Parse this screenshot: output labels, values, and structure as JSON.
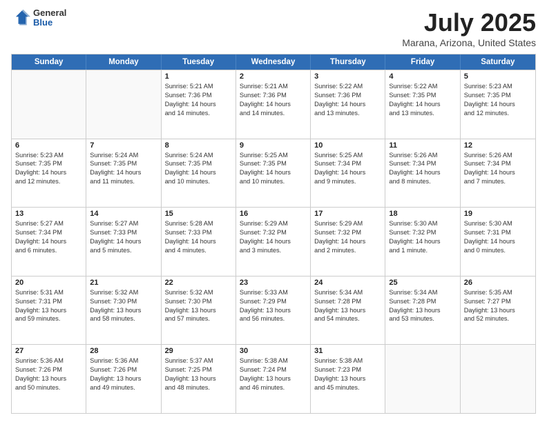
{
  "header": {
    "logo": {
      "general": "General",
      "blue": "Blue"
    },
    "title": "July 2025",
    "subtitle": "Marana, Arizona, United States"
  },
  "calendar": {
    "days_of_week": [
      "Sunday",
      "Monday",
      "Tuesday",
      "Wednesday",
      "Thursday",
      "Friday",
      "Saturday"
    ],
    "rows": [
      [
        {
          "day": "",
          "empty": true
        },
        {
          "day": "",
          "empty": true
        },
        {
          "day": "1",
          "lines": [
            "Sunrise: 5:21 AM",
            "Sunset: 7:36 PM",
            "Daylight: 14 hours",
            "and 14 minutes."
          ]
        },
        {
          "day": "2",
          "lines": [
            "Sunrise: 5:21 AM",
            "Sunset: 7:36 PM",
            "Daylight: 14 hours",
            "and 14 minutes."
          ]
        },
        {
          "day": "3",
          "lines": [
            "Sunrise: 5:22 AM",
            "Sunset: 7:36 PM",
            "Daylight: 14 hours",
            "and 13 minutes."
          ]
        },
        {
          "day": "4",
          "lines": [
            "Sunrise: 5:22 AM",
            "Sunset: 7:35 PM",
            "Daylight: 14 hours",
            "and 13 minutes."
          ]
        },
        {
          "day": "5",
          "lines": [
            "Sunrise: 5:23 AM",
            "Sunset: 7:35 PM",
            "Daylight: 14 hours",
            "and 12 minutes."
          ]
        }
      ],
      [
        {
          "day": "6",
          "lines": [
            "Sunrise: 5:23 AM",
            "Sunset: 7:35 PM",
            "Daylight: 14 hours",
            "and 12 minutes."
          ]
        },
        {
          "day": "7",
          "lines": [
            "Sunrise: 5:24 AM",
            "Sunset: 7:35 PM",
            "Daylight: 14 hours",
            "and 11 minutes."
          ]
        },
        {
          "day": "8",
          "lines": [
            "Sunrise: 5:24 AM",
            "Sunset: 7:35 PM",
            "Daylight: 14 hours",
            "and 10 minutes."
          ]
        },
        {
          "day": "9",
          "lines": [
            "Sunrise: 5:25 AM",
            "Sunset: 7:35 PM",
            "Daylight: 14 hours",
            "and 10 minutes."
          ]
        },
        {
          "day": "10",
          "lines": [
            "Sunrise: 5:25 AM",
            "Sunset: 7:34 PM",
            "Daylight: 14 hours",
            "and 9 minutes."
          ]
        },
        {
          "day": "11",
          "lines": [
            "Sunrise: 5:26 AM",
            "Sunset: 7:34 PM",
            "Daylight: 14 hours",
            "and 8 minutes."
          ]
        },
        {
          "day": "12",
          "lines": [
            "Sunrise: 5:26 AM",
            "Sunset: 7:34 PM",
            "Daylight: 14 hours",
            "and 7 minutes."
          ]
        }
      ],
      [
        {
          "day": "13",
          "lines": [
            "Sunrise: 5:27 AM",
            "Sunset: 7:34 PM",
            "Daylight: 14 hours",
            "and 6 minutes."
          ]
        },
        {
          "day": "14",
          "lines": [
            "Sunrise: 5:27 AM",
            "Sunset: 7:33 PM",
            "Daylight: 14 hours",
            "and 5 minutes."
          ]
        },
        {
          "day": "15",
          "lines": [
            "Sunrise: 5:28 AM",
            "Sunset: 7:33 PM",
            "Daylight: 14 hours",
            "and 4 minutes."
          ]
        },
        {
          "day": "16",
          "lines": [
            "Sunrise: 5:29 AM",
            "Sunset: 7:32 PM",
            "Daylight: 14 hours",
            "and 3 minutes."
          ]
        },
        {
          "day": "17",
          "lines": [
            "Sunrise: 5:29 AM",
            "Sunset: 7:32 PM",
            "Daylight: 14 hours",
            "and 2 minutes."
          ]
        },
        {
          "day": "18",
          "lines": [
            "Sunrise: 5:30 AM",
            "Sunset: 7:32 PM",
            "Daylight: 14 hours",
            "and 1 minute."
          ]
        },
        {
          "day": "19",
          "lines": [
            "Sunrise: 5:30 AM",
            "Sunset: 7:31 PM",
            "Daylight: 14 hours",
            "and 0 minutes."
          ]
        }
      ],
      [
        {
          "day": "20",
          "lines": [
            "Sunrise: 5:31 AM",
            "Sunset: 7:31 PM",
            "Daylight: 13 hours",
            "and 59 minutes."
          ]
        },
        {
          "day": "21",
          "lines": [
            "Sunrise: 5:32 AM",
            "Sunset: 7:30 PM",
            "Daylight: 13 hours",
            "and 58 minutes."
          ]
        },
        {
          "day": "22",
          "lines": [
            "Sunrise: 5:32 AM",
            "Sunset: 7:30 PM",
            "Daylight: 13 hours",
            "and 57 minutes."
          ]
        },
        {
          "day": "23",
          "lines": [
            "Sunrise: 5:33 AM",
            "Sunset: 7:29 PM",
            "Daylight: 13 hours",
            "and 56 minutes."
          ]
        },
        {
          "day": "24",
          "lines": [
            "Sunrise: 5:34 AM",
            "Sunset: 7:28 PM",
            "Daylight: 13 hours",
            "and 54 minutes."
          ]
        },
        {
          "day": "25",
          "lines": [
            "Sunrise: 5:34 AM",
            "Sunset: 7:28 PM",
            "Daylight: 13 hours",
            "and 53 minutes."
          ]
        },
        {
          "day": "26",
          "lines": [
            "Sunrise: 5:35 AM",
            "Sunset: 7:27 PM",
            "Daylight: 13 hours",
            "and 52 minutes."
          ]
        }
      ],
      [
        {
          "day": "27",
          "lines": [
            "Sunrise: 5:36 AM",
            "Sunset: 7:26 PM",
            "Daylight: 13 hours",
            "and 50 minutes."
          ]
        },
        {
          "day": "28",
          "lines": [
            "Sunrise: 5:36 AM",
            "Sunset: 7:26 PM",
            "Daylight: 13 hours",
            "and 49 minutes."
          ]
        },
        {
          "day": "29",
          "lines": [
            "Sunrise: 5:37 AM",
            "Sunset: 7:25 PM",
            "Daylight: 13 hours",
            "and 48 minutes."
          ]
        },
        {
          "day": "30",
          "lines": [
            "Sunrise: 5:38 AM",
            "Sunset: 7:24 PM",
            "Daylight: 13 hours",
            "and 46 minutes."
          ]
        },
        {
          "day": "31",
          "lines": [
            "Sunrise: 5:38 AM",
            "Sunset: 7:23 PM",
            "Daylight: 13 hours",
            "and 45 minutes."
          ]
        },
        {
          "day": "",
          "empty": true
        },
        {
          "day": "",
          "empty": true
        }
      ]
    ]
  }
}
